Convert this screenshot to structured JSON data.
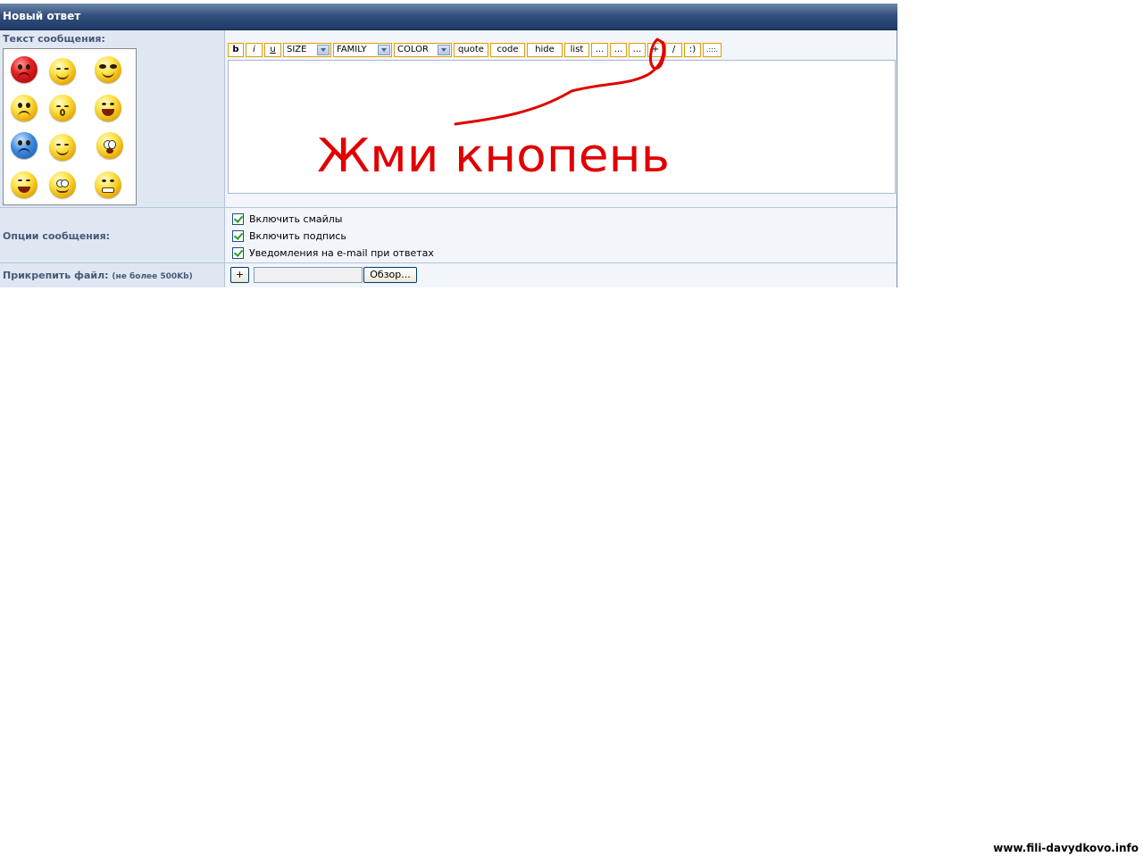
{
  "header": {
    "title": "Новый ответ"
  },
  "message": {
    "label": "Текст сообщения:",
    "smileys": [
      "angry-icon",
      "grin-icon",
      "cool-icon",
      "cry-icon",
      "eyes-closed-icon",
      "laugh-icon",
      "sad-blue-icon",
      "smile-icon",
      "shocked-icon",
      "rofl-icon",
      "dizzy-icon",
      "grimace-icon"
    ],
    "toolbar": {
      "bold": "b",
      "italic": "i",
      "underline": "u",
      "size": "SIZE",
      "family": "FAMILY",
      "color": "COLOR",
      "quote": "quote",
      "code": "code",
      "hide": "hide",
      "list": "list",
      "more1": "...",
      "more2": "...",
      "more3": "...",
      "plus": "+",
      "slash": "/",
      "smile": ":)",
      "misc": ".:::."
    },
    "annotation": "Жми кнопень"
  },
  "options": {
    "label": "Опции сообщения:",
    "items": [
      {
        "label": "Включить смайлы",
        "checked": true
      },
      {
        "label": "Включить подпись",
        "checked": true
      },
      {
        "label": "Уведомления на e-mail при ответах",
        "checked": true
      }
    ]
  },
  "attach": {
    "label": "Прикрепить файл:",
    "note": "(не более 500Kb)",
    "add_label": "+",
    "browse_label": "Обзор..."
  },
  "footer": {
    "watermark": "www.fili-davydkovo.info"
  },
  "colors": {
    "accent": "#1f3a66",
    "scribble": "#e00000",
    "button_border": "#e0a000"
  }
}
